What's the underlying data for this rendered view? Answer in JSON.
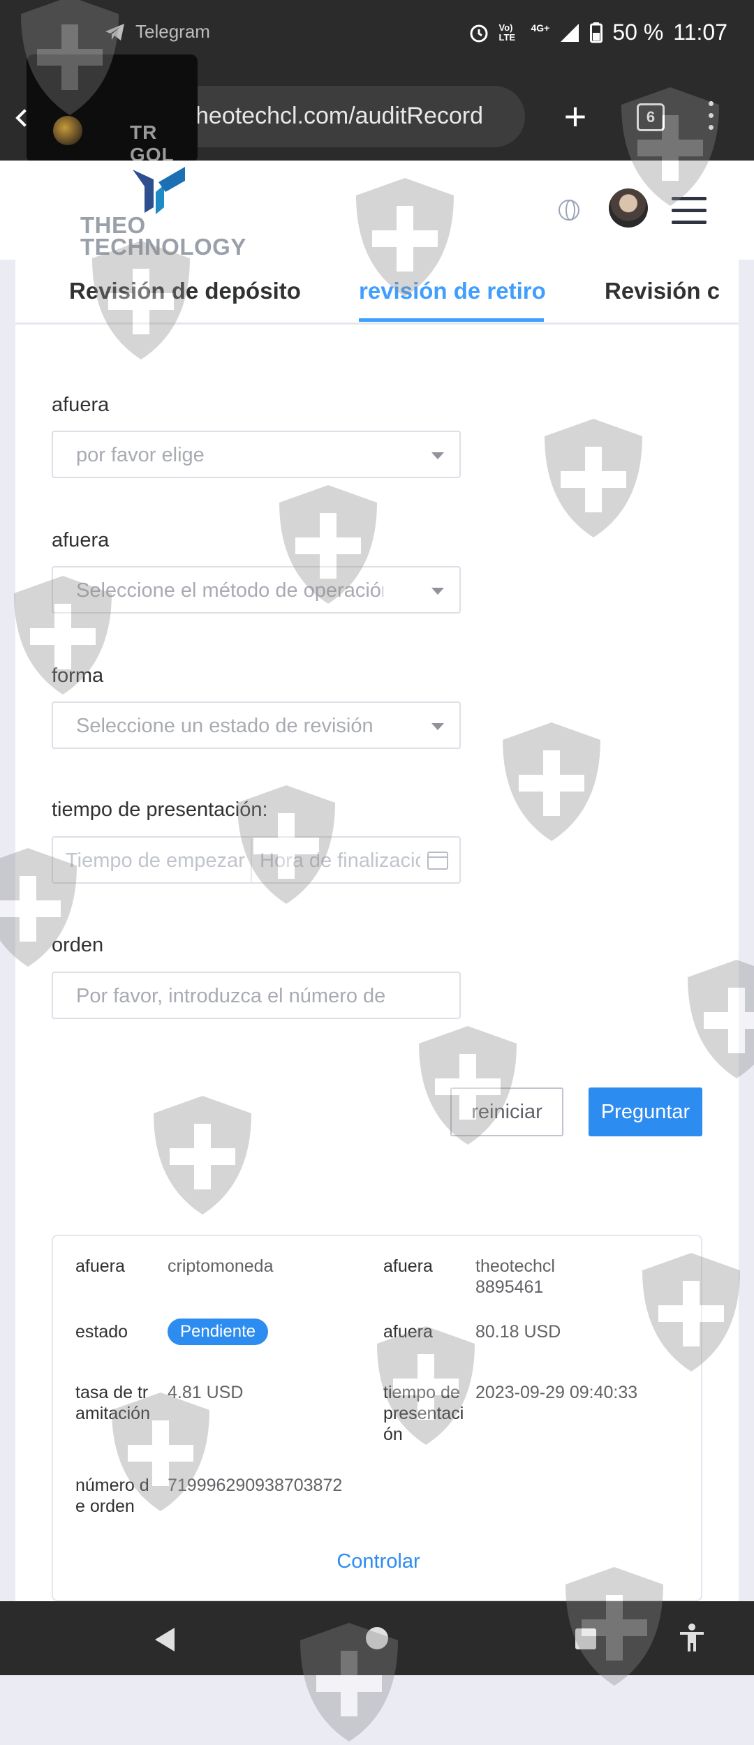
{
  "status_bar": {
    "notification_app": "Telegram",
    "network": "4G+",
    "volte": "Vo) LTE",
    "battery": "50 %",
    "time": "11:07"
  },
  "browser": {
    "url": "heotechcl.com/auditRecord",
    "tab_count": "6"
  },
  "pip": {
    "title": "TR GOL"
  },
  "header": {
    "logo_line1": "THEO",
    "logo_line2": "TECHNOLOGY"
  },
  "tabs": [
    {
      "label": "Revisión de depósito",
      "active": false
    },
    {
      "label": "revisión de retiro",
      "active": true
    },
    {
      "label": "Revisión c",
      "active": false
    }
  ],
  "form": {
    "field1": {
      "label": "afuera",
      "placeholder": "por favor elige"
    },
    "field2": {
      "label": "afuera",
      "placeholder": "Seleccione el método de operación"
    },
    "field3": {
      "label": "forma",
      "placeholder": "Seleccione un estado de revisión"
    },
    "field4": {
      "label": "tiempo de presentación",
      "start_placeholder": "Tiempo de empezar",
      "end_placeholder": "Hora de finalización"
    },
    "field5": {
      "label": "orden",
      "placeholder": "Por favor, introduzca el número de orden"
    },
    "reset_label": "reiniciar",
    "query_label": "Preguntar"
  },
  "record": {
    "rows": [
      {
        "k1": "afuera",
        "v1": "criptomoneda",
        "k2": "afuera",
        "v2": "theotechcl 8895461"
      },
      {
        "k1": "estado",
        "v1": "Pendiente",
        "k2": "afuera",
        "v2": "80.18 USD"
      },
      {
        "k1": "tasa de tramitación",
        "v1": "4.81 USD",
        "k2": "tiempo de presentación",
        "v2": "2023-09-29 09:40:33"
      },
      {
        "k1": "número de orden",
        "v1": "719996290938703872"
      }
    ],
    "action_label": "Controlar"
  },
  "colors": {
    "accent": "#409eff",
    "button_primary": "#2d8cf0",
    "system_bar": "#2b2b2b"
  }
}
